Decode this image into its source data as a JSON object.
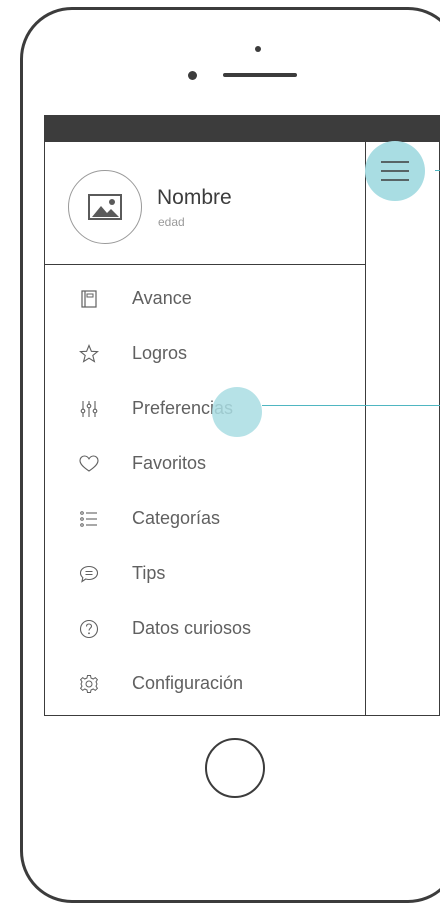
{
  "profile": {
    "name": "Nombre",
    "age": "edad"
  },
  "menu": [
    {
      "label": "Avance",
      "icon": "notebook-icon"
    },
    {
      "label": "Logros",
      "icon": "star-icon"
    },
    {
      "label": "Preferencias",
      "icon": "sliders-icon"
    },
    {
      "label": "Favoritos",
      "icon": "heart-icon"
    },
    {
      "label": "Categorías",
      "icon": "list-icon"
    },
    {
      "label": "Tips",
      "icon": "chat-icon"
    },
    {
      "label": "Datos curiosos",
      "icon": "question-icon"
    },
    {
      "label": "Configuración",
      "icon": "gear-icon"
    }
  ],
  "colors": {
    "frame": "#3c3c3c",
    "accent": "#a9dde3",
    "accent_line": "#4fb6c1",
    "text": "#606060"
  }
}
